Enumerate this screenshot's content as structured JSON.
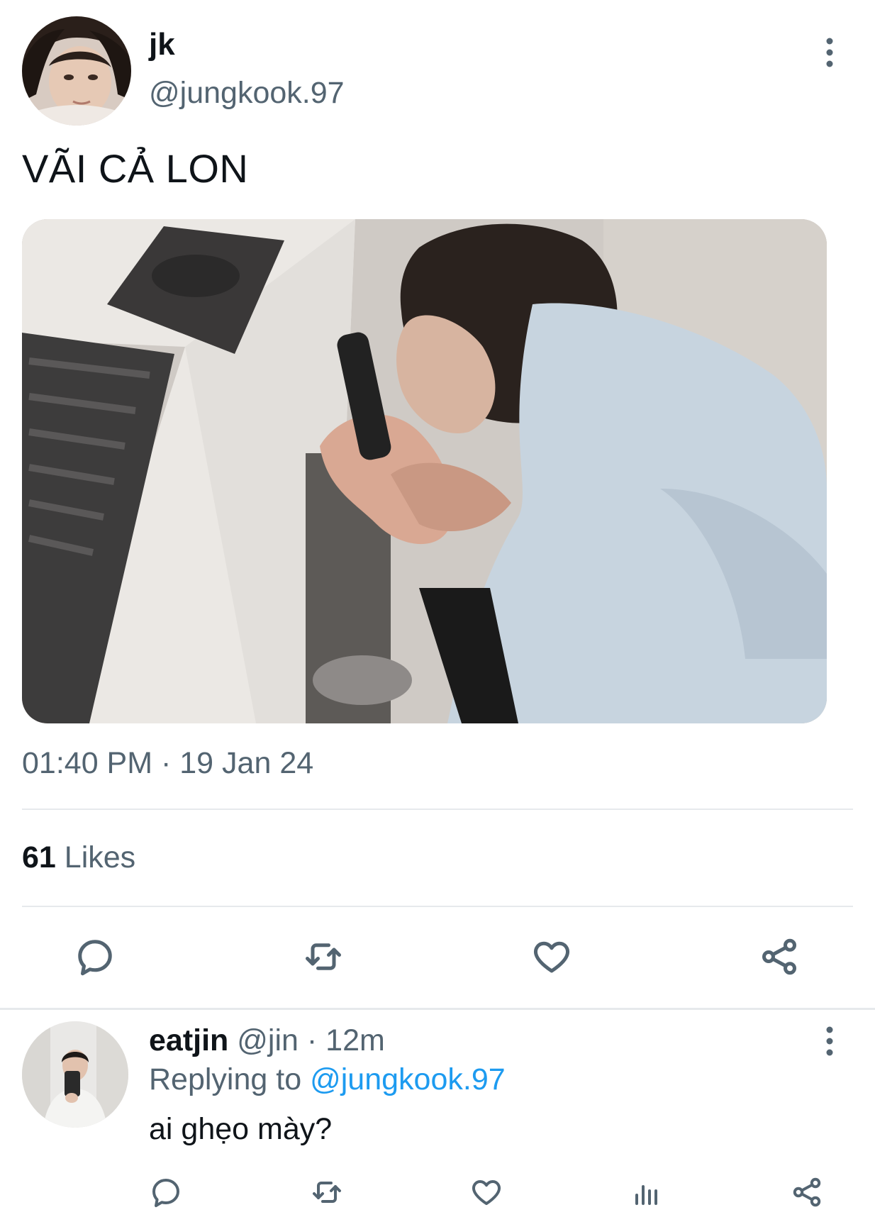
{
  "tweet": {
    "display_name": "jk",
    "handle": "@jungkook.97",
    "text": "VÃI CẢ LON",
    "timestamp": "01:40 PM · 19 Jan 24",
    "likes_count": "61",
    "likes_label": "Likes",
    "actions": [
      "reply-icon",
      "retweet-icon",
      "like-icon",
      "share-icon"
    ]
  },
  "reply": {
    "display_name": "eatjin",
    "handle": "@jin",
    "separator": "·",
    "time": "12m",
    "replying_prefix": "Replying to",
    "replying_to": "@jungkook.97",
    "text": "ai ghẹo mày?",
    "actions": [
      "reply-icon",
      "retweet-icon",
      "like-icon",
      "analytics-icon",
      "share-icon"
    ]
  },
  "colors": {
    "primary_text": "#0f1419",
    "secondary_text": "#536471",
    "link": "#1d9bf0",
    "divider": "#e6e9ec"
  }
}
